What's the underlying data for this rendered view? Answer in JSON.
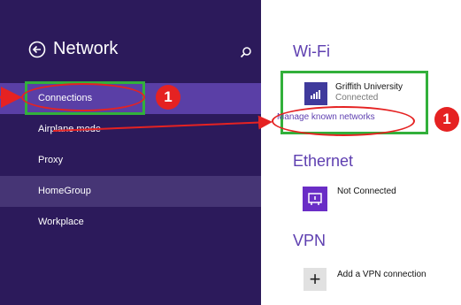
{
  "sidebar": {
    "title": "Network",
    "items": [
      {
        "label": "Connections"
      },
      {
        "label": "Airplane mode"
      },
      {
        "label": "Proxy"
      },
      {
        "label": "HomeGroup"
      },
      {
        "label": "Workplace"
      }
    ]
  },
  "wifi": {
    "title": "Wi-Fi",
    "network_name": "Griffith University",
    "network_status": "Connected",
    "manage_link": "Manage known networks"
  },
  "ethernet": {
    "title": "Ethernet",
    "status": "Not Connected"
  },
  "vpn": {
    "title": "VPN",
    "add_icon_glyph": "+",
    "add_label": "Add a VPN connection"
  },
  "annotations": {
    "badge_connections": "1",
    "badge_manage": "1"
  },
  "colors": {
    "sidebar_bg": "#2c1a5b",
    "sidebar_active": "#5a3fa6",
    "accent": "#5e3fb0",
    "highlight_green": "#32b03b",
    "annotation_red": "#e52222"
  }
}
